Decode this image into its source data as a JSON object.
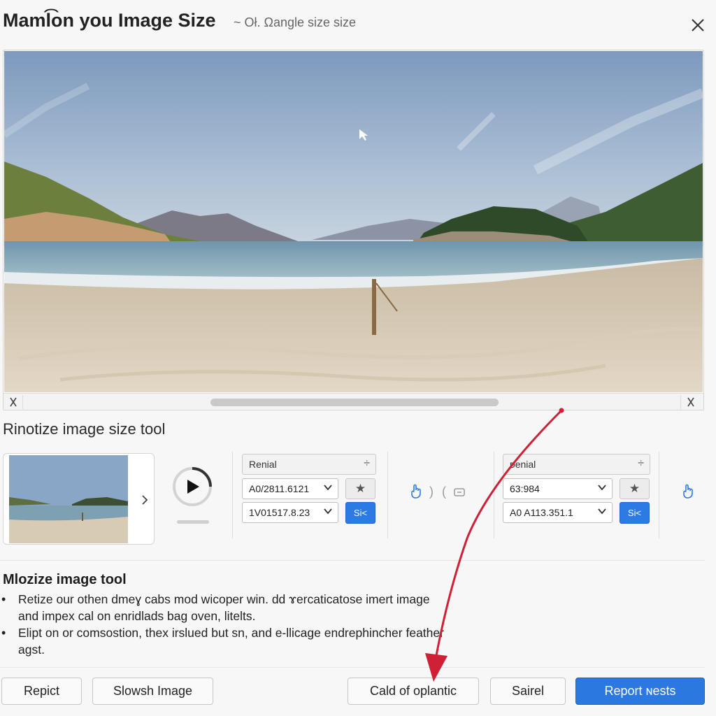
{
  "header": {
    "title": "Maml͡on you Image Size",
    "subtitle": "~ Oł. Ωangle size size"
  },
  "toolbar": {
    "section_title": "Rinotize image size tool",
    "group1": {
      "header_label": "Renial",
      "field1_value": "A0/2811.6121",
      "field2_value": "1V01517.8.23",
      "action_label": "Si<"
    },
    "group2": {
      "header_label": "ᴅenial",
      "field1_value": "63:984",
      "field2_value": "A0 A113.351.1",
      "action_label": "Si<"
    }
  },
  "description": {
    "title": "Mlozize image tool",
    "items": [
      "Retize our othen dmeɣ cabs mod wicoper win. dd ɤercaticatose imert image and impex cal on enridlads bag oven, litelts.",
      "Elipt on or comsostion, thex irslued but sn, and e-llicage endrephincher feather agst."
    ]
  },
  "footer": {
    "buttons": [
      {
        "label": "Repict"
      },
      {
        "label": "Slowsh Image"
      },
      {
        "label": "Cald of oplantic"
      },
      {
        "label": "Sairel"
      },
      {
        "label": "Report ɴests"
      }
    ]
  },
  "icons": {
    "close": "close-icon",
    "play": "play-icon",
    "star": "star-icon",
    "hand": "hand-pointer-icon",
    "chevron": "chevron-right-icon"
  },
  "colors": {
    "accent": "#2a78e0",
    "annotation_arrow": "#d02035"
  }
}
